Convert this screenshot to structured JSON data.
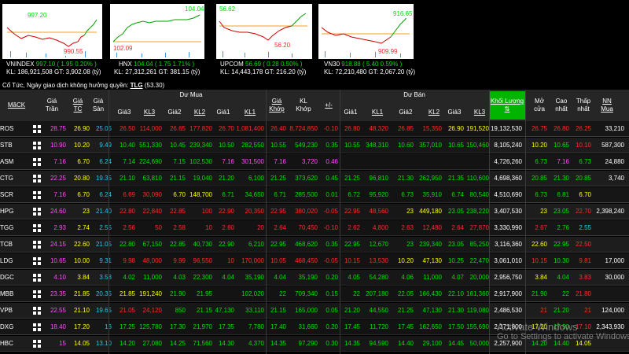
{
  "indices": [
    {
      "name": "VNINDEX",
      "value": "997.10",
      "change": "( 1.95",
      "pct": "0.20% )",
      "kl": "186,921,508",
      "gt": "3,902.08",
      "hi_label": "997.20",
      "lo_label": "990.55",
      "kl_label": "KL:",
      "gt_label": "GT:",
      "unit": "(tỷ)",
      "direction": "up"
    },
    {
      "name": "HNX",
      "value": "104.04",
      "change": "( 1.75",
      "pct": "1.71% )",
      "kl": "27,312,261",
      "gt": "381.15",
      "hi_label": "104.04",
      "lo_label": "102.09",
      "kl_label": "KL:",
      "gt_label": "GT:",
      "unit": "(tỷ)",
      "direction": "up"
    },
    {
      "name": "UPCOM",
      "value": "56.69",
      "change": "( 0.28",
      "pct": "0.50% )",
      "kl": "14,443,178",
      "gt": "216.20",
      "hi_label": "56.62",
      "lo_label": "56.20",
      "kl_label": "KL:",
      "gt_label": "GT:",
      "unit": "(tỷ)",
      "direction": "up"
    },
    {
      "name": "VN30",
      "value": "918.88",
      "change": "( 5.40",
      "pct": "0.59% )",
      "kl": "72,210,480",
      "gt": "2,067.20",
      "hi_label": "916.65",
      "lo_label": "909.99",
      "kl_label": "KL:",
      "gt_label": "GT:",
      "unit": "(tỷ)",
      "direction": "up"
    }
  ],
  "note": {
    "text": "Cổ Tức, Ngày giao dịch không hưởng quyền:",
    "code": "TLG",
    "value": "(53.30)"
  },
  "header": {
    "ma_ck": "MãCK",
    "gia_tran": "Giá Trần",
    "gia_tc": "Giá TC",
    "gia_san": "Giá Sàn",
    "du_mua": "Dư Mua",
    "du_ban": "Dư Bán",
    "gia3": "Giá3",
    "kl3": "KL3",
    "gia2": "Giá2",
    "kl2": "KL2",
    "gia1": "Giá1",
    "kl1": "KL1",
    "gia_khop": "Giá Khớp",
    "kl_khop": "KL Khớp",
    "plusminus": "+/-",
    "khoi_luong": "Khối Lượng",
    "sort_arrow": "⇅",
    "mo_cua": "Mở cửa",
    "cao_nhat": "Cao nhất",
    "thap_nhat": "Thấp nhất",
    "nn_mua": "NN Mua"
  },
  "rows": [
    {
      "sym": "ROS",
      "tran": "28.75",
      "tc": "26.90",
      "san": "25.05",
      "b3": "26.50",
      "bk3": "114,000",
      "b2": "26.65",
      "bk2": "177,820",
      "b1": "26.70",
      "bk1": "1,081,400",
      "gk": "26.40",
      "klk": "8,724,850",
      "pm": "-0.10",
      "a1": "26.80",
      "ak1": "48,320",
      "a2": "26.85",
      "ak2": "15,350",
      "a3": "26.90",
      "ak3": "191,520",
      "tkl": "19,132,530",
      "mo": "26.75",
      "cao": "26.80",
      "thap": "26.25",
      "nn": "33,210",
      "cl": {
        "b3": "down",
        "b2": "down",
        "b1": "down",
        "gk": "down",
        "pm": "down",
        "a1": "down",
        "a2": "down",
        "a3": "ref",
        "mo": "down",
        "cao": "down",
        "thap": "down"
      }
    },
    {
      "sym": "STB",
      "tran": "10.90",
      "tc": "10.20",
      "san": "9.49",
      "b3": "10.40",
      "bk3": "551,330",
      "b2": "10.45",
      "bk2": "239,340",
      "b1": "10.50",
      "bk1": "282,550",
      "gk": "10.55",
      "klk": "549,230",
      "pm": "0.35",
      "a1": "10.55",
      "ak1": "348,310",
      "a2": "10.60",
      "ak2": "357,010",
      "a3": "10.65",
      "ak3": "150,460",
      "tkl": "8,105,240",
      "mo": "10.20",
      "cao": "10.65",
      "thap": "10.10",
      "nn": "587,300",
      "cl": {
        "b3": "up",
        "b2": "up",
        "b1": "up",
        "gk": "up",
        "pm": "up",
        "a1": "up",
        "a2": "up",
        "a3": "up",
        "mo": "ref",
        "cao": "up",
        "thap": "down"
      }
    },
    {
      "sym": "ASM",
      "tran": "7.16",
      "tc": "6.70",
      "san": "6.24",
      "b3": "7.14",
      "bk3": "224,690",
      "b2": "7.15",
      "bk2": "102,530",
      "b1": "7.16",
      "bk1": "301,500",
      "gk": "7.16",
      "klk": "3,720",
      "pm": "0.46",
      "a1": "",
      "ak1": "",
      "a2": "",
      "ak2": "",
      "a3": "",
      "ak3": "",
      "tkl": "4,726,260",
      "mo": "6.73",
      "cao": "7.16",
      "thap": "6.73",
      "nn": "24,880",
      "cl": {
        "b3": "up",
        "b2": "up",
        "b1": "ceil",
        "gk": "ceil",
        "pm": "ceil",
        "mo": "up",
        "cao": "ceil",
        "thap": "up"
      }
    },
    {
      "sym": "CTG",
      "tran": "22.25",
      "tc": "20.80",
      "san": "19.35",
      "b3": "21.10",
      "bk3": "63,810",
      "b2": "21.15",
      "bk2": "19,040",
      "b1": "21.20",
      "bk1": "6,100",
      "gk": "21.25",
      "klk": "373,620",
      "pm": "0.45",
      "a1": "21.25",
      "ak1": "96,810",
      "a2": "21.30",
      "ak2": "262,950",
      "a3": "21.35",
      "ak3": "110,600",
      "tkl": "4,698,360",
      "mo": "20.85",
      "cao": "21.30",
      "thap": "20.85",
      "nn": "3,740",
      "cl": {
        "b3": "up",
        "b2": "up",
        "b1": "up",
        "gk": "up",
        "pm": "up",
        "a1": "up",
        "a2": "up",
        "a3": "up",
        "mo": "up",
        "cao": "up",
        "thap": "up"
      }
    },
    {
      "sym": "SCR",
      "tran": "7.16",
      "tc": "6.70",
      "san": "6.24",
      "b3": "6.69",
      "bk3": "30,090",
      "b2": "6.70",
      "bk2": "148,700",
      "b1": "6.71",
      "bk1": "34,650",
      "gk": "6.71",
      "klk": "285,500",
      "pm": "0.01",
      "a1": "6.72",
      "ak1": "95,920",
      "a2": "6.73",
      "ak2": "35,910",
      "a3": "6.74",
      "ak3": "80,540",
      "tkl": "4,510,690",
      "mo": "6.73",
      "cao": "6.81",
      "thap": "6.70",
      "nn": "",
      "cl": {
        "b3": "down",
        "b2": "ref",
        "b1": "up",
        "gk": "up",
        "pm": "up",
        "a1": "up",
        "a2": "up",
        "a3": "up",
        "mo": "up",
        "cao": "up",
        "thap": "ref"
      }
    },
    {
      "sym": "HPG",
      "tran": "24.60",
      "tc": "23",
      "san": "21.40",
      "b3": "22.80",
      "bk3": "22,840",
      "b2": "22.85",
      "bk2": "100",
      "b1": "22.90",
      "bk1": "20,350",
      "gk": "22.95",
      "klk": "380,020",
      "pm": "-0.05",
      "a1": "22.95",
      "ak1": "48,560",
      "a2": "23",
      "ak2": "449,180",
      "a3": "23.05",
      "ak3": "238,220",
      "tkl": "3,407,530",
      "mo": "23",
      "cao": "23.05",
      "thap": "22.70",
      "nn": "2,398,240",
      "cl": {
        "b3": "down",
        "b2": "down",
        "b1": "down",
        "gk": "down",
        "pm": "down",
        "a1": "down",
        "a2": "ref",
        "a3": "up",
        "mo": "ref",
        "cao": "up",
        "thap": "down"
      }
    },
    {
      "sym": "TGG",
      "tran": "2.93",
      "tc": "2.74",
      "san": "2.55",
      "b3": "2.56",
      "bk3": "50",
      "b2": "2.58",
      "bk2": "10",
      "b1": "2.60",
      "bk1": "20",
      "gk": "2.64",
      "klk": "70,450",
      "pm": "-0.10",
      "a1": "2.62",
      "ak1": "4,800",
      "a2": "2.63",
      "ak2": "12,480",
      "a3": "2.64",
      "ak3": "27,870",
      "tkl": "3,330,990",
      "mo": "2.67",
      "cao": "2.76",
      "thap": "2.55",
      "nn": "",
      "cl": {
        "b3": "down",
        "b2": "down",
        "b1": "down",
        "gk": "down",
        "pm": "down",
        "a1": "down",
        "a2": "down",
        "a3": "down",
        "mo": "down",
        "cao": "up",
        "thap": "floor"
      }
    },
    {
      "sym": "TCB",
      "tran": "24.15",
      "tc": "22.60",
      "san": "21.05",
      "b3": "22.80",
      "bk3": "67,150",
      "b2": "22.85",
      "bk2": "40,730",
      "b1": "22.90",
      "bk1": "6,210",
      "gk": "22.95",
      "klk": "468,620",
      "pm": "0.35",
      "a1": "22.95",
      "ak1": "12,670",
      "a2": "23",
      "ak2": "239,340",
      "a3": "23.05",
      "ak3": "85,250",
      "tkl": "3,116,360",
      "mo": "22.60",
      "cao": "22.95",
      "thap": "22.50",
      "nn": "",
      "cl": {
        "b3": "up",
        "b2": "up",
        "b1": "up",
        "gk": "up",
        "pm": "up",
        "a1": "up",
        "a2": "up",
        "a3": "up",
        "mo": "ref",
        "cao": "up",
        "thap": "down"
      }
    },
    {
      "sym": "LDG",
      "tran": "10.65",
      "tc": "10.00",
      "san": "9.31",
      "b3": "9.98",
      "bk3": "48,000",
      "b2": "9.99",
      "bk2": "96,550",
      "b1": "10",
      "bk1": "170,000",
      "gk": "10.05",
      "klk": "468,450",
      "pm": "-0.05",
      "a1": "10.15",
      "ak1": "13,530",
      "a2": "10.20",
      "ak2": "47,130",
      "a3": "10.25",
      "ak3": "22,470",
      "tkl": "3,061,010",
      "mo": "10.15",
      "cao": "10.30",
      "thap": "9.81",
      "nn": "17,000",
      "cl": {
        "b3": "down",
        "b2": "down",
        "b1": "down",
        "gk": "down",
        "pm": "down",
        "a1": "down",
        "a2": "ref",
        "a3": "up",
        "mo": "down",
        "cao": "up",
        "thap": "down"
      }
    },
    {
      "sym": "DGC",
      "tran": "4.10",
      "tc": "3.84",
      "san": "3.58",
      "b3": "4.02",
      "bk3": "11,000",
      "b2": "4.03",
      "bk2": "22,300",
      "b1": "4.04",
      "bk1": "35,190",
      "gk": "4.04",
      "klk": "35,190",
      "pm": "0.20",
      "a1": "4.05",
      "ak1": "54,280",
      "a2": "4.06",
      "ak2": "11,000",
      "a3": "4.07",
      "ak3": "20,000",
      "tkl": "2,956,750",
      "mo": "3.84",
      "cao": "4.04",
      "thap": "3.83",
      "nn": "30,000",
      "cl": {
        "b3": "up",
        "b2": "up",
        "b1": "up",
        "gk": "up",
        "pm": "up",
        "a1": "up",
        "a2": "up",
        "a3": "up",
        "mo": "ref",
        "cao": "up",
        "thap": "down"
      }
    },
    {
      "sym": "MBB",
      "tran": "23.35",
      "tc": "21.85",
      "san": "20.35",
      "b3": "21.85",
      "bk3": "191,240",
      "b2": "21.90",
      "bk2": "21.95",
      "b1": "",
      "bk1": "102,020",
      "gk": "22",
      "klk": "709,340",
      "pm": "0.15",
      "a1": "22",
      "ak1": "207,180",
      "a2": "22.05",
      "ak2": "166,430",
      "a3": "22.10",
      "ak3": "161,360",
      "tkl": "2,917,900",
      "mo": "21.90",
      "cao": "22",
      "thap": "21.80",
      "nn": "",
      "cl": {
        "b3": "ref",
        "b2": "up",
        "b1": "up",
        "gk": "up",
        "pm": "up",
        "a1": "up",
        "a2": "up",
        "a3": "up",
        "mo": "up",
        "cao": "up",
        "thap": "down"
      }
    },
    {
      "sym": "VPB",
      "tran": "22.55",
      "tc": "21.10",
      "san": "19.65",
      "b3": "21.05",
      "bk3": "24,120",
      "b2": "850",
      "bk2": "21.15",
      "b1": "47,130",
      "bk1": "33,110",
      "gk": "21.15",
      "klk": "165,000",
      "pm": "0.05",
      "a1": "21.20",
      "ak1": "44,550",
      "a2": "21.25",
      "ak2": "47,130",
      "a3": "21.30",
      "ak3": "119,080",
      "tkl": "2,486,530",
      "mo": "21",
      "cao": "21.20",
      "thap": "21",
      "nn": "124,000",
      "cl": {
        "b3": "down",
        "b2": "up",
        "b1": "up",
        "gk": "up",
        "pm": "up",
        "a1": "up",
        "a2": "up",
        "a3": "up",
        "mo": "down",
        "cao": "up",
        "thap": "down"
      }
    },
    {
      "sym": "DXG",
      "tran": "18.40",
      "tc": "17.20",
      "san": "16",
      "b3": "17.25",
      "bk3": "125,780",
      "b2": "17.30",
      "bk2": "21,970",
      "b1": "17.35",
      "bk1": "7,780",
      "gk": "17.40",
      "klk": "31,660",
      "pm": "0.20",
      "a1": "17.45",
      "ak1": "11,720",
      "a2": "17.45",
      "ak2": "162,650",
      "a3": "17.50",
      "ak3": "155,690",
      "tkl": "2,371,800",
      "mo": "17.20",
      "cao": "17.50",
      "thap": "17.10",
      "nn": "2,343,930",
      "cl": {
        "b3": "up",
        "b2": "up",
        "b1": "up",
        "gk": "up",
        "pm": "up",
        "a1": "up",
        "a2": "up",
        "a3": "up",
        "mo": "ref",
        "cao": "up",
        "thap": "down"
      }
    },
    {
      "sym": "HBC",
      "tran": "15",
      "tc": "14.05",
      "san": "13.10",
      "b3": "14.20",
      "bk3": "27,080",
      "b2": "14.25",
      "bk2": "71,560",
      "b1": "14.30",
      "bk1": "4,370",
      "gk": "14.35",
      "klk": "97,290",
      "pm": "0.30",
      "a1": "14.35",
      "ak1": "94,590",
      "a2": "14.40",
      "ak2": "29,100",
      "a3": "14.45",
      "ak3": "50,000",
      "tkl": "2,257,900",
      "mo": "14.20",
      "cao": "14.40",
      "thap": "14.05",
      "nn": "",
      "cl": {
        "b3": "up",
        "b2": "up",
        "b1": "up",
        "gk": "up",
        "pm": "up",
        "a1": "up",
        "a2": "up",
        "a3": "up",
        "mo": "up",
        "cao": "up",
        "thap": "ref"
      }
    }
  ],
  "watermark": {
    "title": "Activate Windows",
    "sub": "Go to Settings to activate Windows."
  },
  "colors": {
    "up": "#00e000",
    "down": "#ff2b2b",
    "ref": "#ffff00",
    "ceil": "#ff4dff",
    "floor": "#29c6e6",
    "highlight": "#00b400"
  }
}
